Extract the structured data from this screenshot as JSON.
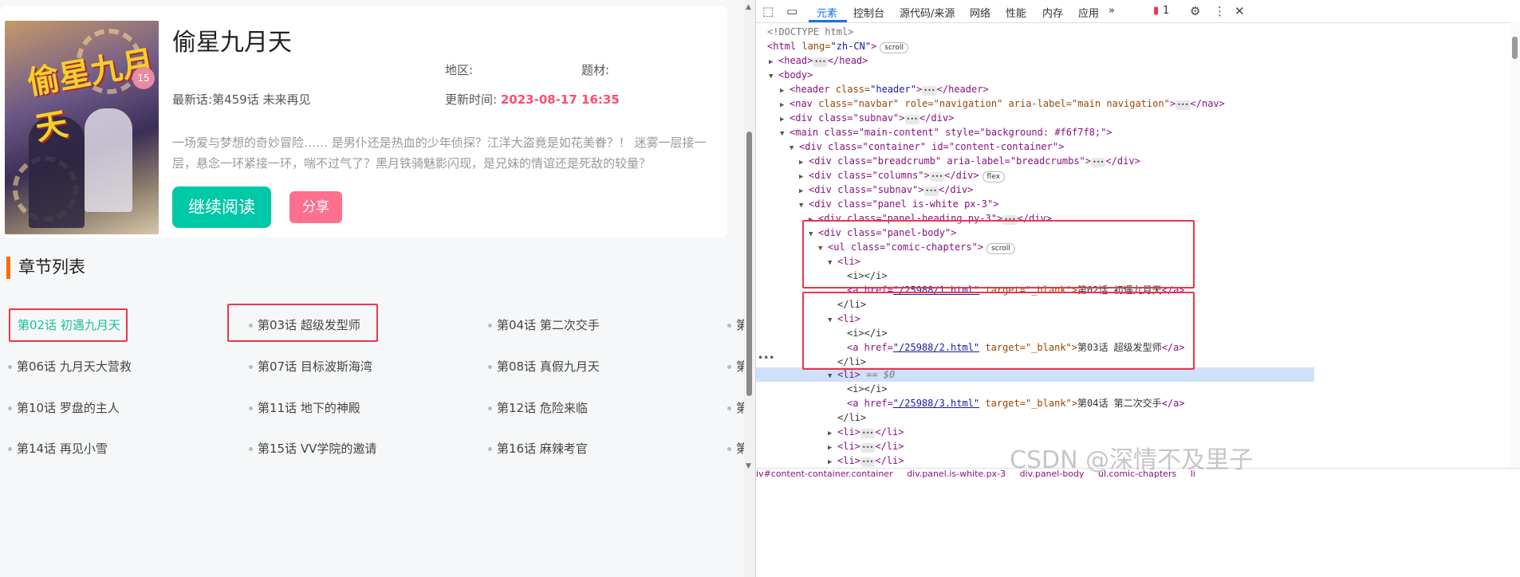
{
  "comic": {
    "title": "偷星九月天",
    "region_label": "地区:",
    "genre_label": "题材:",
    "latest_label": "最新话:",
    "latest_value": "第459话 未来再见",
    "updated_label": "更新时间:",
    "updated_value": "2023-08-17 16:35",
    "description": "一场爱与梦想的奇妙冒险…… 是男仆还是热血的少年侦探？江洋大盗竟是如花美眷？！ 迷雾一层接一层，悬念一环紧接一环，喘不过气了？黑月铁骑魅影闪现，是兄妹的情谊还是死敌的较量？",
    "read_button": "继续阅读",
    "share_button": "分享",
    "cover_logo": "偷星九月天",
    "cover_vol": "15"
  },
  "chapters_section": {
    "title": "章节列表",
    "items": [
      "第02话 初遇九月天",
      "第03话 超级发型师",
      "第04话 第二次交手",
      "第",
      "第06话 九月天大营救",
      "第07话 目标波斯海湾",
      "第08话 真假九月天",
      "第",
      "第10话 罗盘的主人",
      "第11话 地下的神殿",
      "第12话 危险来临",
      "第",
      "第14话 再见小雪",
      "第15话 VV学院的邀请",
      "第16话 麻辣考官",
      "第"
    ]
  },
  "devtools": {
    "tabs": [
      "元素",
      "控制台",
      "源代码/来源",
      "网络",
      "性能",
      "内存",
      "应用"
    ],
    "issues_count": "1",
    "lines": {
      "l1": "<!DOCTYPE html>",
      "l2_tag": "<html ",
      "l2_attr": "lang=",
      "l2_val": "\"zh-CN\"",
      "l2_end": ">",
      "scroll_badge": "scroll",
      "flex_badge": "flex",
      "head": "<head>",
      "head_end": "</head>",
      "body": "<body>",
      "header_open": "<header ",
      "header_attr": "class=",
      "header_val": "\"header\"",
      "header_close": "</header>",
      "nav_open": "<nav ",
      "nav_attrs": "class=\"navbar\" role=\"navigation\" aria-label=\"main navigation\"",
      "nav_close": "</nav>",
      "subnav": "<div class=\"subnav\">",
      "div_close": "</div>",
      "main": "<main class=\"main-content\" style=\"background: #f6f7f8;\">",
      "container": "<div class=\"container\" id=\"content-container\">",
      "breadcrumb": "<div class=\"breadcrumb\" aria-label=\"breadcrumbs\">",
      "columns": "<div class=\"columns\">",
      "subnav2": "<div class=\"subnav\">",
      "panel": "<div class=\"panel is-white px-3\">",
      "panel_heading": "<div class=\"panel-heading py-3\">",
      "panel_body": "<div class=\"panel-body\">",
      "ul": "<ul class=\"comic-chapters\">",
      "li": "<li>",
      "li_close": "</li>",
      "i_pair": "<i></i>",
      "a_open": "<a href=",
      "href1": "\"/25988/1.html\"",
      "href2": "\"/25988/2.html\"",
      "href3": "\"/25988/3.html\"",
      "target": " target=\"_blank\">",
      "a1_text": "第02话 初遇九月天",
      "a2_text": "第03话 超级发型师",
      "a3_text": "第04话 第二次交手",
      "a_close": "</a>",
      "sel_marker": " == $0"
    },
    "breadcrumbs": [
      "iv#content-container.container",
      "div.panel.is-white.px-3",
      "div.panel-body",
      "ul.comic-chapters",
      "li"
    ]
  },
  "watermark": "CSDN @深情不及里子"
}
